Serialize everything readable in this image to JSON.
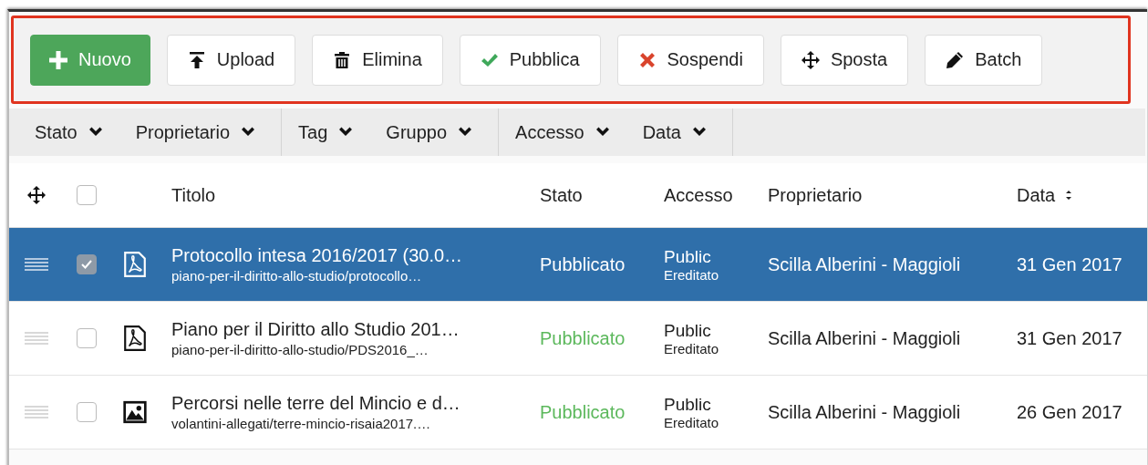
{
  "toolbar": {
    "buttons": [
      {
        "label": "Nuovo",
        "kind": "new"
      },
      {
        "label": "Upload",
        "kind": "upload"
      },
      {
        "label": "Elimina",
        "kind": "delete"
      },
      {
        "label": "Pubblica",
        "kind": "publish"
      },
      {
        "label": "Sospendi",
        "kind": "suspend"
      },
      {
        "label": "Sposta",
        "kind": "move"
      },
      {
        "label": "Batch",
        "kind": "batch"
      }
    ]
  },
  "filter_groups": [
    {
      "filters": [
        {
          "label": "Stato"
        },
        {
          "label": "Proprietario"
        }
      ]
    },
    {
      "filters": [
        {
          "label": "Tag"
        },
        {
          "label": "Gruppo"
        }
      ]
    },
    {
      "filters": [
        {
          "label": "Accesso"
        },
        {
          "label": "Data"
        }
      ]
    }
  ],
  "table": {
    "header_checked": false,
    "columns": [
      "Titolo",
      "Stato",
      "Accesso",
      "Proprietario",
      "Data"
    ],
    "rows": [
      {
        "selected": true,
        "checked": true,
        "kind": "pdf",
        "title": "Protocollo intesa 2016/2017 (30.0…",
        "path": "piano-per-il-diritto-allo-studio/protocollo…",
        "status": "Pubblicato",
        "access": "Public",
        "access_note": "Ereditato",
        "owner": "Scilla Alberini - Maggioli",
        "date": "31 Gen 2017"
      },
      {
        "selected": false,
        "checked": false,
        "kind": "pdf",
        "title": "Piano per il Diritto allo Studio 201…",
        "path": "piano-per-il-diritto-allo-studio/PDS2016_…",
        "status": "Pubblicato",
        "access": "Public",
        "access_note": "Ereditato",
        "owner": "Scilla Alberini - Maggioli",
        "date": "31 Gen 2017"
      },
      {
        "selected": false,
        "checked": false,
        "kind": "image",
        "title": "Percorsi nelle terre del Mincio e d…",
        "path": "volantini-allegati/terre-mincio-risaia2017.…",
        "status": "Pubblicato",
        "access": "Public",
        "access_note": "Ereditato",
        "owner": "Scilla Alberini - Maggioli",
        "date": "26 Gen 2017"
      }
    ]
  }
}
